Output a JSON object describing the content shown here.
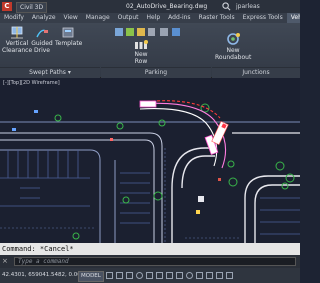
{
  "app": {
    "menu_letter": "C",
    "workspace": "Civil 3D",
    "doc_title": "02_AutoDrive_Bearing.dwg",
    "user": "jparleas"
  },
  "tabs": [
    "Modify",
    "Analyze",
    "View",
    "Manage",
    "Output",
    "Help",
    "Add-ins",
    "Raster Tools",
    "Express Tools",
    "Vehicle"
  ],
  "ribbon": {
    "buttons": {
      "vertical_clearance": [
        "Vertical",
        "Clearance"
      ],
      "guided_drive": [
        "Guided",
        "Drive"
      ],
      "template": "Template",
      "new_row": [
        "New",
        "Row"
      ],
      "new_roundabout": [
        "New",
        "Roundabout"
      ]
    },
    "sections": {
      "swept_paths": "Swept Paths ▾",
      "parking": "Parking",
      "junctions": "Junctions"
    }
  },
  "viewport": {
    "label": "[-][Top][2D Wireframe]"
  },
  "command": {
    "history": "Command: *Cancel*",
    "placeholder": "Type a command",
    "close": "×"
  },
  "status": {
    "coords": "42.4301, 659041.5482, 0.0000",
    "model": "MODEL"
  },
  "colors": {
    "accent": "#c0392b",
    "ribbon_bg": "#3a414d",
    "canvas_bg": "#1b2030"
  }
}
